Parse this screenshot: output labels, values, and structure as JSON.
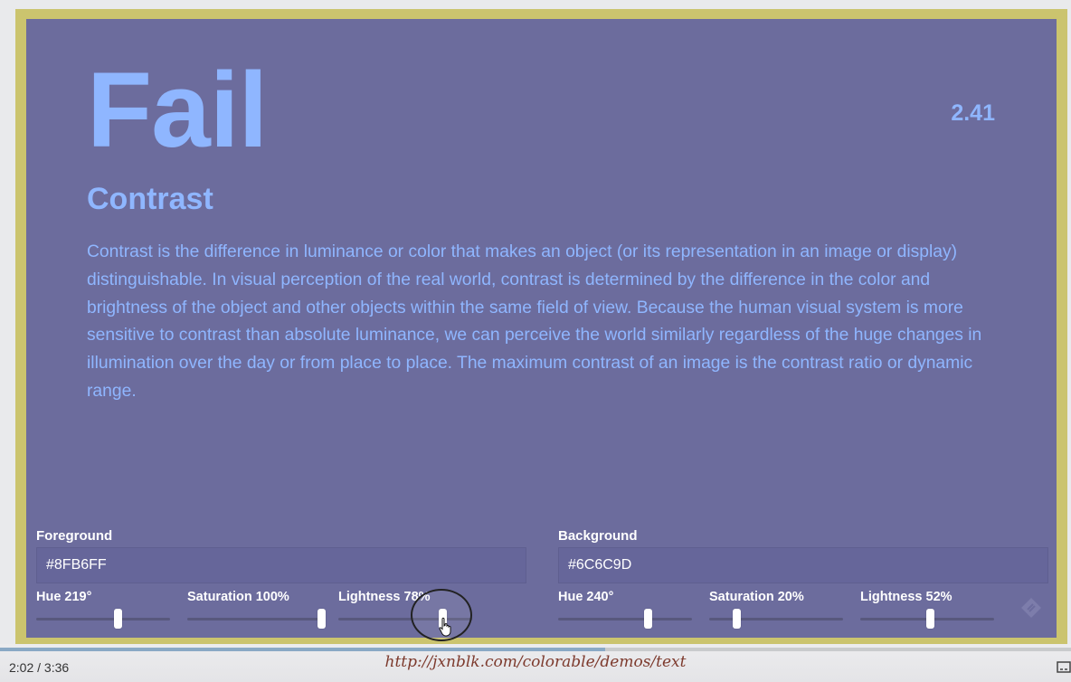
{
  "demo": {
    "verdict": "Fail",
    "ratio": "2.41",
    "heading": "Contrast",
    "paragraph": "Contrast is the difference in luminance or color that makes an object (or its representation in an image or display) distinguishable. In visual perception of the real world, contrast is determined by the difference in the color and brightness of the object and other objects within the same field of view. Because the human visual system is more sensitive to contrast than absolute luminance, we can perceive the world similarly regardless of the huge changes in illumination over the day or from place to place. The maximum contrast of an image is the contrast ratio or dynamic range.",
    "text_color": "#8FB6FF",
    "background_color": "#6C6C9D"
  },
  "foreground": {
    "title": "Foreground",
    "hex_value": "#8FB6FF",
    "sliders": [
      {
        "label": "Hue 219°",
        "fraction": 0.608
      },
      {
        "label": "Saturation 100%",
        "fraction": 1.0
      },
      {
        "label": "Lightness 78%",
        "fraction": 0.78
      }
    ]
  },
  "background": {
    "title": "Background",
    "hex_value": "#6C6C9D",
    "sliders": [
      {
        "label": "Hue 240°",
        "fraction": 0.667
      },
      {
        "label": "Saturation 20%",
        "fraction": 0.2
      },
      {
        "label": "Lightness 52%",
        "fraction": 0.52
      }
    ]
  },
  "video": {
    "current_time": "2:02",
    "separator": "/",
    "duration": "3:36",
    "progress_fraction": 0.565,
    "caption_url": "http://jxnblk.com/colorable/demos/text"
  },
  "icons": {
    "corner": "logo-diamond-icon",
    "cursor": "hand-pointer-icon",
    "captions": "closed-captions-icon"
  }
}
